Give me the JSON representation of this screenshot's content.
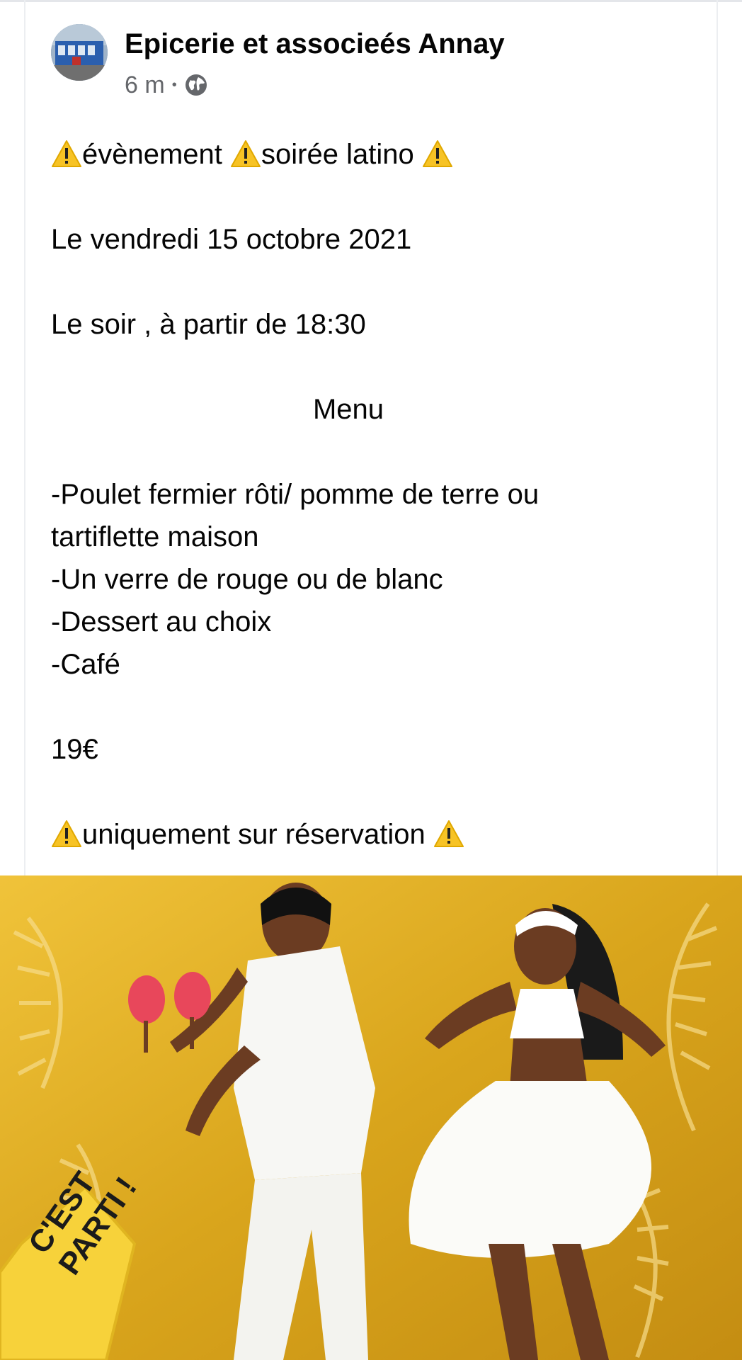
{
  "post": {
    "page_name": "Epicerie et associeés Annay",
    "time": "6 m",
    "separator": "•",
    "visibility_icon": "globe-icon",
    "lines": {
      "l1_a": "évènement ",
      "l1_b": "soirée latino ",
      "l2": "Le vendredi 15 octobre 2021",
      "l3": "Le soir , à partir de 18:30",
      "l4": "Menu",
      "l5": "-Poulet fermier rôti/ pomme de terre  ou",
      "l6": "tartiflette maison",
      "l7": "-Un verre de rouge ou de blanc",
      "l8": "-Dessert au choix",
      "l9": "-Café",
      "l10": "19€",
      "l11": "uniquement sur réservation "
    }
  },
  "image": {
    "stamp_line1": "C'EST",
    "stamp_line2": "PARTI !"
  },
  "colors": {
    "text": "#050505",
    "meta": "#65676b",
    "warning": "#f7c325",
    "poster_gold": "#d9a51c"
  }
}
